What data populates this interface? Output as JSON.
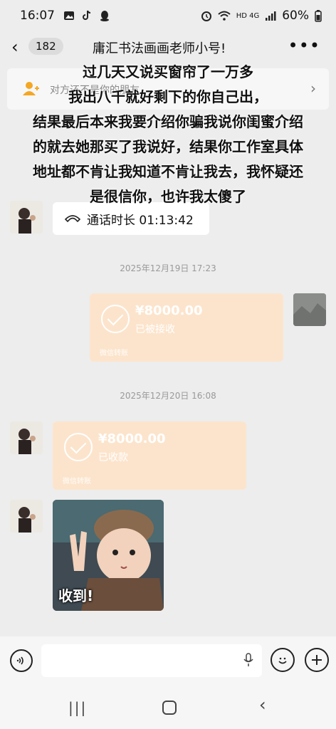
{
  "statusbar": {
    "time": "16:07",
    "battery": "60%",
    "network": "HD 4G"
  },
  "header": {
    "back_icon": "‹",
    "unread_count": "182",
    "title": "庸汇书法画画老师小号!",
    "more_icon": "•••"
  },
  "notice": {
    "text": "对方还不是你的朋友",
    "chevron": "›"
  },
  "overlay_text": [
    "过几天又说买窗帘了一万多",
    "我出八千就好剩下的你自己出，",
    "结果最后本来我要介绍你骗我说你闺蜜介绍",
    "的就去她那买了我说好，结果你工作室具体",
    "地址都不肯让我知道不肯让我去，我怀疑还",
    "是很信你，也许我太傻了"
  ],
  "messages": {
    "call": {
      "label": "通话时长 01:13:42",
      "icon": "phone-icon"
    },
    "ts1": "2025年12月19日 17:23",
    "sent_transfer": {
      "amount": "¥8000.00",
      "status": "已被接收",
      "footer": "微信转账"
    },
    "ts2": "2025年12月20日 16:08",
    "recv_transfer": {
      "amount": "¥8000.00",
      "status": "已收款",
      "footer": "微信转账"
    },
    "sticker_caption": "收到!"
  },
  "colors": {
    "background": "#ededed",
    "transfer": "#fce4cc",
    "bubble_white": "#ffffff"
  }
}
